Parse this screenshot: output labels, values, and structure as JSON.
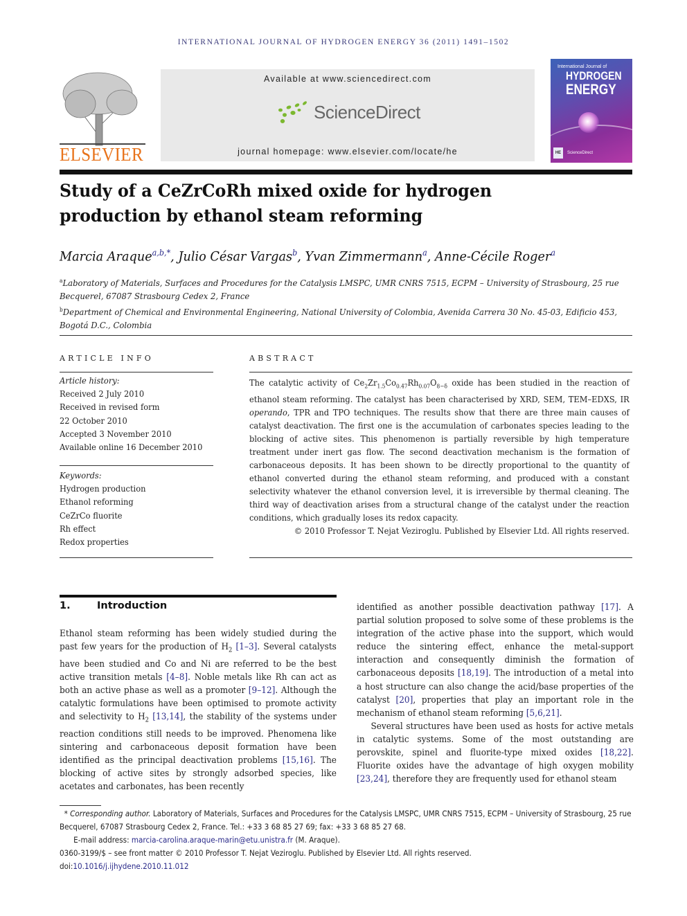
{
  "header": {
    "running_head": "INTERNATIONAL JOURNAL OF HYDROGEN ENERGY 36 (2011) 1491–1502",
    "publisher_logo": "ELSEVIER",
    "available_at": "Available at www.sciencedirect.com",
    "sciencedirect_logo": "ScienceDirect",
    "journal_homepage": "journal homepage: www.elsevier.com/locate/he",
    "cover": {
      "subtitle": "International Journal of",
      "title_line1": "HYDROGEN",
      "title_line2": "ENERGY",
      "badge": "HE",
      "footer": "ScienceDirect"
    }
  },
  "article": {
    "title": "Study of a CeZrCoRh mixed oxide for hydrogen production by ethanol steam reforming",
    "authors": [
      {
        "name": "Marcia Araque",
        "sup": "a,b,*"
      },
      {
        "name": "Julio César Vargas",
        "sup": "b"
      },
      {
        "name": "Yvan Zimmermann",
        "sup": "a"
      },
      {
        "name": "Anne-Cécile Roger",
        "sup": "a"
      }
    ],
    "affiliations": [
      {
        "mark": "a",
        "text": "Laboratory of Materials, Surfaces and Procedures for the Catalysis LMSPC, UMR CNRS 7515, ECPM – University of Strasbourg, 25 rue Becquerel, 67087 Strasbourg Cedex 2, France"
      },
      {
        "mark": "b",
        "text": "Department of Chemical and Environmental Engineering, National University of Colombia, Avenida Carrera 30 No. 45-03, Edificio 453, Bogotá D.C., Colombia"
      }
    ]
  },
  "article_info": {
    "heading": "ARTICLE INFO",
    "history_label": "Article history:",
    "history": [
      "Received 2 July 2010",
      "Received in revised form",
      "22 October 2010",
      "Accepted 3 November 2010",
      "Available online 16 December 2010"
    ],
    "keywords_label": "Keywords:",
    "keywords": [
      "Hydrogen production",
      "Ethanol reforming",
      "CeZrCo fluorite",
      "Rh effect",
      "Redox properties"
    ]
  },
  "abstract": {
    "heading": "ABSTRACT",
    "intro": "The catalytic activity of ",
    "formula": {
      "ce": "Ce",
      "ce_sub": "2",
      "zr": "Zr",
      "zr_sub": "1.5",
      "co": "Co",
      "co_sub": "0.47",
      "rh": "Rh",
      "rh_sub": "0.07",
      "o": "O",
      "o_sub": "8−δ"
    },
    "part1": " oxide has been studied in the reaction of ethanol steam reforming. The catalyst has been characterised by XRD, SEM, TEM–EDXS, IR ",
    "operando": "operando",
    "part2": ", TPR and TPO techniques. The results show that there are three main causes of catalyst deactivation. The first one is the accumulation of carbonates species leading to the blocking of active sites. This phenomenon is partially reversible by high temperature treatment under inert gas flow. The second deactivation mechanism is the formation of carbonaceous deposits. It has been shown to be directly proportional to the quantity of ethanol converted during the ethanol steam reforming, and produced with a constant selectivity whatever the ethanol conversion level, it is irreversible by thermal cleaning. The third way of deactivation arises from a structural change of the catalyst under the reaction conditions, which gradually loses its redox capacity.",
    "copyright": "© 2010 Professor T. Nejat Veziroglu. Published by Elsevier Ltd. All rights reserved."
  },
  "introduction": {
    "number": "1.",
    "heading": "Introduction",
    "left": {
      "s1": "Ethanol steam reforming has been widely studied during the past few years for the production of H",
      "s1_sub": "2",
      "r1": "[1–3]",
      "s2": ". Several catalysts have been studied and Co and Ni are referred to be the best active transition metals ",
      "r2": "[4–8]",
      "s3": ". Noble metals like Rh can act as both an active phase as well as a promoter ",
      "r3": "[9–12]",
      "s4": ". Although the catalytic formulations have been optimised to promote activity and selectivity to H",
      "s4_sub": "2",
      "r4": "[13,14]",
      "s5": ", the stability of the systems under reaction conditions still needs to be improved. Phenomena like sintering and carbonaceous deposit formation have been identified as the principal deactivation problems ",
      "r5": "[15,16]",
      "s6": ". The blocking of active sites by strongly adsorbed species, like acetates and carbonates, has been recently"
    },
    "right": {
      "s1": "identified as another possible deactivation pathway ",
      "r1": "[17]",
      "s2": ". A partial solution proposed to solve some of these problems is the integration of the active phase into the support, which would reduce the sintering effect, enhance the metal-support interaction and consequently diminish the formation of carbonaceous deposits ",
      "r2": "[18,19]",
      "s3": ". The introduction of a metal into a host structure can also change the acid/base properties of the catalyst ",
      "r3": "[20]",
      "s4": ", properties that play an important role in the mechanism of ethanol steam reforming ",
      "r4": "[5,6,21]",
      "s5": ".",
      "p2_s1": "Several structures have been used as hosts for active metals in catalytic systems. Some of the most outstanding are perovskite, spinel and fluorite-type mixed oxides ",
      "p2_r1": "[18,22]",
      "p2_s2": ". Fluorite oxides have the advantage of high oxygen mobility ",
      "p2_r2": "[23,24]",
      "p2_s3": ", therefore they are frequently used for ethanol steam"
    }
  },
  "footnotes": {
    "corresponding_label": "Corresponding author.",
    "corresponding_text": " Laboratory of Materials, Surfaces and Procedures for the Catalysis LMSPC, UMR CNRS 7515, ECPM – University of Strasbourg, 25 rue Becquerel, 67087 Strasbourg Cedex 2, France. Tel.: +33 3 68 85 27 69; fax: +33 3 68 85 27 68.",
    "email_label": "E-mail address: ",
    "email": "marcia-carolina.araque-marin@etu.unistra.fr",
    "email_suffix": " (M. Araque).",
    "issn": "0360-3199/$ – see front matter © 2010 Professor T. Nejat Veziroglu. Published by Elsevier Ltd. All rights reserved.",
    "doi_label": "doi:",
    "doi": "10.1016/j.ijhydene.2010.11.012"
  },
  "colors": {
    "link": "#2b2b8a",
    "elsevier_orange": "#e8731b",
    "sciencedirect_green": "#7cb82f"
  }
}
